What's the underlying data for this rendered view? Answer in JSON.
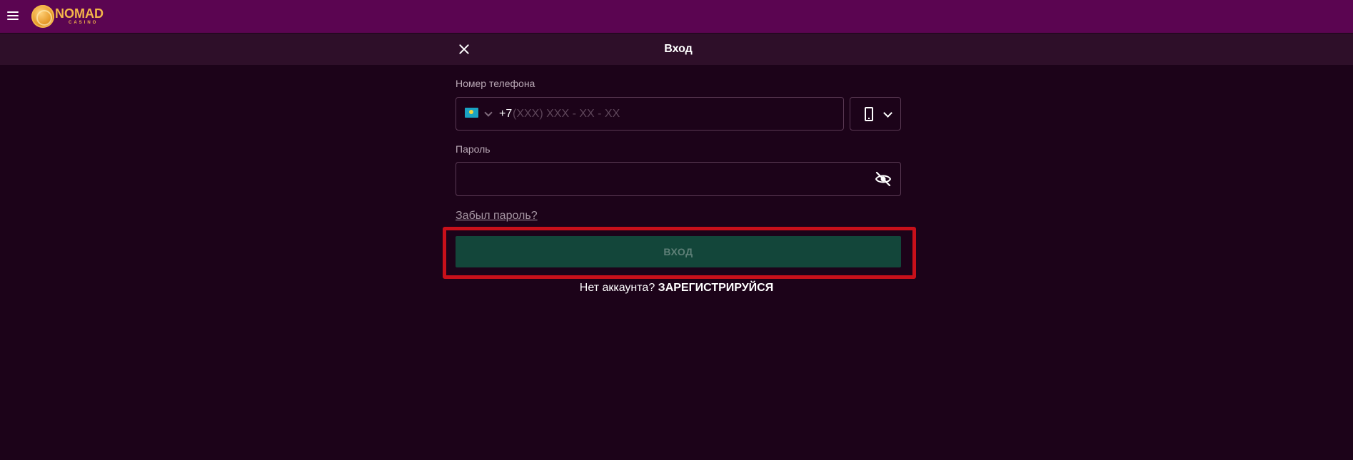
{
  "topbar": {
    "menu_icon": "hamburger-icon",
    "logo": {
      "title": "NOMAD",
      "subtitle": "CASINO"
    },
    "background": "#5b0551"
  },
  "modal": {
    "title": "Вход",
    "close_icon": "close-icon"
  },
  "form": {
    "phone": {
      "label": "Номер телефона",
      "country_flag": "kazakhstan-flag-icon",
      "prefix": "+7",
      "placeholder": "(XXX) XXX - XX - XX",
      "value": ""
    },
    "login_method": {
      "icon": "mobile-phone-icon",
      "selected": "phone"
    },
    "password": {
      "label": "Пароль",
      "value": "",
      "toggle_icon": "eye-off-icon"
    },
    "forgot_password": "Забыл пароль?",
    "submit_label": "ВХОД",
    "no_account_text": "Нет аккаунта?",
    "register_link": "ЗАРЕГИСТРИРУЙСЯ"
  },
  "colors": {
    "page_bg": "#1c0319",
    "subheader_bg": "#2e0f29",
    "button_bg": "#13463a",
    "highlight": "#c8101a",
    "accent": "#f4b64a"
  }
}
